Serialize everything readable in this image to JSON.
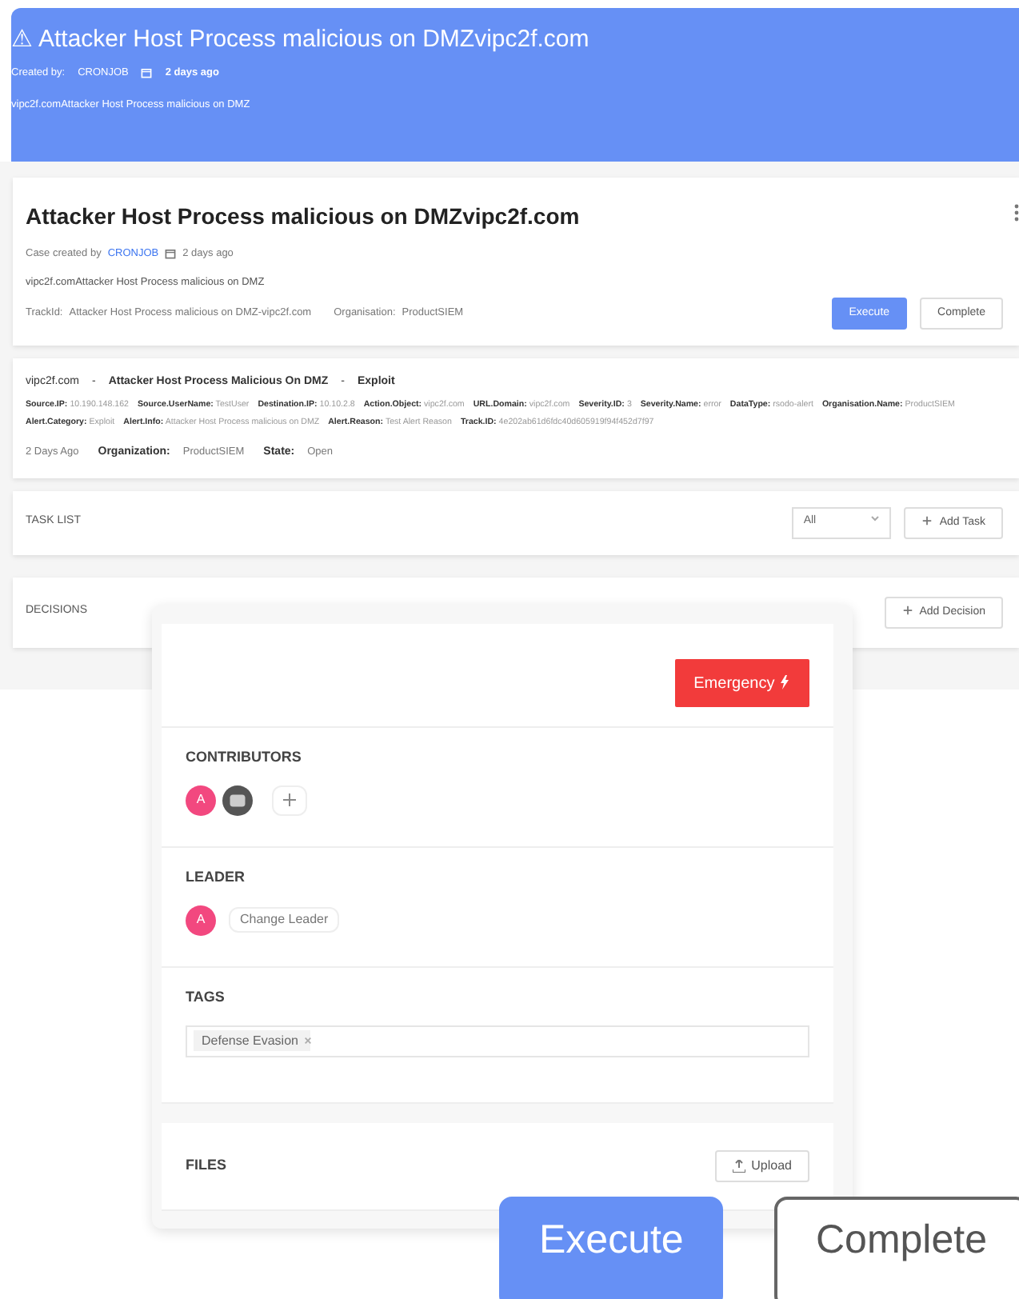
{
  "header": {
    "icon": "⚠",
    "title": "Attacker Host Process malicious on DMZvipc2f.com",
    "created_label": "Created by:",
    "creator": "CRONJOB",
    "date": "2 days ago",
    "description": "vipc2f.comAttacker Host Process malicious on DMZ"
  },
  "case": {
    "title": "Attacker Host Process malicious on DMZvipc2f.com",
    "created_label": "Case created by",
    "creator": "CRONJOB",
    "date": "2 days ago",
    "description": "vipc2f.comAttacker Host Process malicious on DMZ",
    "track_label": "TrackId:",
    "track_value": "Attacker Host Process malicious on DMZ-vipc2f.com",
    "org_label": "Organisation:",
    "org_value": "ProductSIEM",
    "buttons": [
      {
        "label": "Execute",
        "kind": "primary"
      },
      {
        "label": "Complete",
        "kind": "secondary"
      }
    ]
  },
  "alert": {
    "source": "vipc2f.com",
    "name": "Attacker Host Process Malicious On DMZ",
    "category": "Exploit",
    "separators": [
      "-",
      "-"
    ],
    "fields": [
      {
        "label": "Source.IP:",
        "value": "10.190.148.162"
      },
      {
        "label": "Source.UserName:",
        "value": "TestUser"
      },
      {
        "label": "Destination.IP:",
        "value": "10.10.2.8"
      },
      {
        "label": "Action.Object:",
        "value": "vipc2f.com"
      },
      {
        "label": "URL.Domain:",
        "value": "vipc2f.com"
      },
      {
        "label": "Severity.ID:",
        "value": "3"
      },
      {
        "label": "Severity.Name:",
        "value": "error"
      },
      {
        "label": "DataType:",
        "value": "rsodo-alert"
      },
      {
        "label": "Organisation.Name:",
        "value": "ProductSIEM"
      },
      {
        "label": "Alert.Category:",
        "value": "Exploit"
      },
      {
        "label": "Alert.Info:",
        "value": "Attacker Host Process malicious on DMZ"
      },
      {
        "label": "Alert.Reason:",
        "value": "Test Alert Reason"
      },
      {
        "label": "Track.ID:",
        "value": "4e202ab61d6fdc40d605919f94f452d7f97"
      }
    ],
    "age": "2 Days Ago",
    "org_label": "Organization:",
    "org_value": "ProductSIEM",
    "state_label": "State:",
    "state_value": "Open"
  },
  "task_list": {
    "title": "TASK LIST",
    "filter": "All",
    "add": "Add Task"
  },
  "decisions": {
    "title": "DECISIONS",
    "add": "Add Decision"
  },
  "panel": {
    "priority": "Emergency",
    "contributors_title": "CONTRIBUTORS",
    "contributors": [
      {
        "initial": "A",
        "kind": "letter"
      },
      {
        "kind": "bot"
      }
    ],
    "leader_title": "LEADER",
    "leader": {
      "initial": "A"
    },
    "change_leader": "Change Leader",
    "tags_title": "TAGS",
    "tags": [
      "Defense Evasion"
    ],
    "files_title": "FILES",
    "upload": "Upload"
  },
  "big_buttons": [
    {
      "label": "Execute",
      "kind": "primary"
    },
    {
      "label": "Complete",
      "kind": "secondary"
    }
  ]
}
